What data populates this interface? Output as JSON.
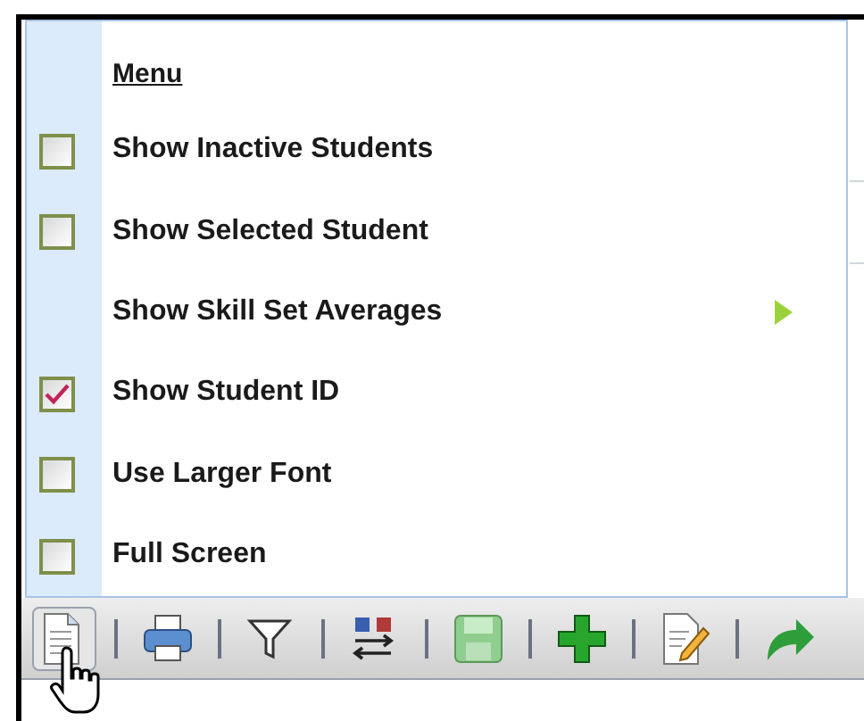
{
  "menu": {
    "title": "Menu",
    "items": [
      {
        "kind": "checkbox",
        "label": "Show Inactive Students",
        "checked": false
      },
      {
        "kind": "checkbox",
        "label": "Show Selected Student",
        "checked": false
      },
      {
        "kind": "submenu",
        "label": "Show Skill Set Averages"
      },
      {
        "kind": "checkbox",
        "label": "Show Student ID",
        "checked": true
      },
      {
        "kind": "checkbox",
        "label": "Use Larger Font",
        "checked": false
      },
      {
        "kind": "checkbox",
        "label": "Full Screen",
        "checked": false
      }
    ]
  },
  "toolbar": {
    "buttons": [
      {
        "kind": "document"
      },
      {
        "kind": "print"
      },
      {
        "kind": "filter"
      },
      {
        "kind": "sort"
      },
      {
        "kind": "save"
      },
      {
        "kind": "add"
      },
      {
        "kind": "edit"
      },
      {
        "kind": "forward"
      }
    ]
  }
}
